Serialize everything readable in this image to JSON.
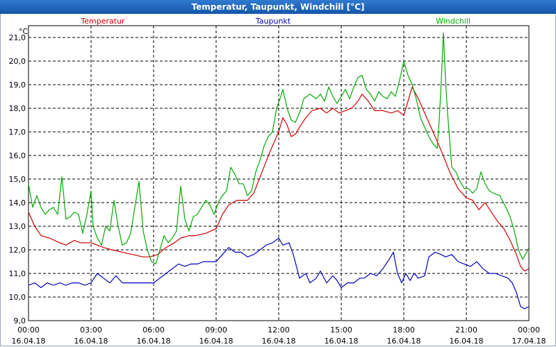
{
  "window": {
    "title": "Temperatur, Taupunkt, Windchill [°C]"
  },
  "chart_data": {
    "type": "line",
    "title": "Temperatur, Taupunkt, Windchill [°C]",
    "ylabel": "°C",
    "xlabel": "",
    "ylim": [
      9.0,
      21.5
    ],
    "xlim": [
      0,
      24
    ],
    "grid": true,
    "legend_position": "top",
    "yticks": [
      "9,0",
      "10,0",
      "11,0",
      "12,0",
      "13,0",
      "14,0",
      "15,0",
      "16,0",
      "17,0",
      "18,0",
      "19,0",
      "20,0",
      "21,0"
    ],
    "xticks": [
      {
        "time": "00:00",
        "date": "16.04.18"
      },
      {
        "time": "03:00",
        "date": "16.04.18"
      },
      {
        "time": "06:00",
        "date": "16.04.18"
      },
      {
        "time": "09:00",
        "date": "16.04.18"
      },
      {
        "time": "12:00",
        "date": "16.04.18"
      },
      {
        "time": "15:00",
        "date": "16.04.18"
      },
      {
        "time": "18:00",
        "date": "16.04.18"
      },
      {
        "time": "21:00",
        "date": "16.04.18"
      },
      {
        "time": "00:00",
        "date": "17.04.18"
      }
    ],
    "series": [
      {
        "name": "Temperatur",
        "color": "#cc0000",
        "points": [
          [
            0.0,
            13.6
          ],
          [
            0.3,
            13.0
          ],
          [
            0.6,
            12.6
          ],
          [
            1.0,
            12.5
          ],
          [
            1.5,
            12.3
          ],
          [
            1.8,
            12.2
          ],
          [
            2.2,
            12.4
          ],
          [
            2.5,
            12.3
          ],
          [
            3.0,
            12.3
          ],
          [
            3.3,
            12.2
          ],
          [
            3.6,
            12.1
          ],
          [
            4.0,
            12.0
          ],
          [
            4.5,
            11.9
          ],
          [
            5.0,
            11.8
          ],
          [
            5.5,
            11.7
          ],
          [
            5.8,
            11.7
          ],
          [
            6.2,
            11.8
          ],
          [
            6.6,
            12.1
          ],
          [
            7.0,
            12.3
          ],
          [
            7.3,
            12.5
          ],
          [
            7.7,
            12.6
          ],
          [
            8.0,
            12.6
          ],
          [
            8.5,
            12.7
          ],
          [
            9.0,
            12.9
          ],
          [
            9.3,
            13.5
          ],
          [
            9.6,
            13.9
          ],
          [
            10.0,
            14.1
          ],
          [
            10.5,
            14.1
          ],
          [
            10.8,
            14.4
          ],
          [
            11.2,
            15.3
          ],
          [
            11.6,
            16.2
          ],
          [
            12.0,
            17.0
          ],
          [
            12.2,
            17.6
          ],
          [
            12.4,
            17.3
          ],
          [
            12.6,
            16.8
          ],
          [
            12.8,
            16.9
          ],
          [
            13.0,
            17.2
          ],
          [
            13.3,
            17.6
          ],
          [
            13.6,
            17.9
          ],
          [
            14.0,
            18.0
          ],
          [
            14.3,
            17.8
          ],
          [
            14.6,
            18.0
          ],
          [
            14.9,
            17.8
          ],
          [
            15.2,
            17.9
          ],
          [
            15.5,
            18.0
          ],
          [
            15.8,
            18.3
          ],
          [
            16.0,
            18.6
          ],
          [
            16.3,
            18.3
          ],
          [
            16.6,
            17.9
          ],
          [
            17.0,
            17.9
          ],
          [
            17.4,
            17.8
          ],
          [
            17.7,
            17.9
          ],
          [
            18.0,
            17.7
          ],
          [
            18.2,
            18.3
          ],
          [
            18.4,
            18.9
          ],
          [
            18.7,
            18.4
          ],
          [
            19.0,
            17.8
          ],
          [
            19.4,
            17.0
          ],
          [
            19.8,
            16.2
          ],
          [
            20.2,
            15.3
          ],
          [
            20.6,
            14.6
          ],
          [
            21.0,
            14.2
          ],
          [
            21.3,
            14.1
          ],
          [
            21.6,
            13.7
          ],
          [
            21.9,
            14.0
          ],
          [
            22.2,
            13.6
          ],
          [
            22.5,
            13.2
          ],
          [
            22.8,
            12.9
          ],
          [
            23.1,
            12.4
          ],
          [
            23.4,
            11.8
          ],
          [
            23.6,
            11.3
          ],
          [
            23.8,
            11.1
          ],
          [
            24.0,
            11.2
          ]
        ]
      },
      {
        "name": "Taupunkt",
        "color": "#0000bb",
        "points": [
          [
            0.0,
            10.5
          ],
          [
            0.3,
            10.6
          ],
          [
            0.6,
            10.4
          ],
          [
            0.9,
            10.6
          ],
          [
            1.2,
            10.5
          ],
          [
            1.5,
            10.6
          ],
          [
            1.8,
            10.5
          ],
          [
            2.1,
            10.6
          ],
          [
            2.4,
            10.6
          ],
          [
            2.7,
            10.5
          ],
          [
            3.0,
            10.6
          ],
          [
            3.3,
            11.0
          ],
          [
            3.6,
            10.8
          ],
          [
            3.9,
            10.6
          ],
          [
            4.2,
            10.9
          ],
          [
            4.5,
            10.6
          ],
          [
            4.8,
            10.6
          ],
          [
            5.1,
            10.6
          ],
          [
            5.4,
            10.6
          ],
          [
            5.7,
            10.6
          ],
          [
            6.0,
            10.6
          ],
          [
            6.3,
            10.8
          ],
          [
            6.6,
            11.0
          ],
          [
            6.9,
            11.2
          ],
          [
            7.2,
            11.4
          ],
          [
            7.5,
            11.3
          ],
          [
            7.8,
            11.4
          ],
          [
            8.1,
            11.4
          ],
          [
            8.4,
            11.5
          ],
          [
            8.7,
            11.5
          ],
          [
            9.0,
            11.5
          ],
          [
            9.3,
            11.8
          ],
          [
            9.6,
            12.1
          ],
          [
            9.9,
            11.9
          ],
          [
            10.2,
            11.9
          ],
          [
            10.5,
            11.7
          ],
          [
            10.8,
            11.8
          ],
          [
            11.1,
            12.0
          ],
          [
            11.4,
            12.2
          ],
          [
            11.7,
            12.3
          ],
          [
            12.0,
            12.5
          ],
          [
            12.2,
            12.2
          ],
          [
            12.5,
            12.3
          ],
          [
            12.7,
            11.8
          ],
          [
            13.0,
            10.8
          ],
          [
            13.3,
            11.0
          ],
          [
            13.5,
            10.6
          ],
          [
            13.8,
            10.8
          ],
          [
            14.0,
            11.1
          ],
          [
            14.3,
            10.6
          ],
          [
            14.6,
            10.9
          ],
          [
            14.8,
            10.7
          ],
          [
            15.0,
            10.4
          ],
          [
            15.3,
            10.6
          ],
          [
            15.6,
            10.6
          ],
          [
            15.9,
            10.8
          ],
          [
            16.1,
            10.8
          ],
          [
            16.4,
            11.0
          ],
          [
            16.7,
            10.9
          ],
          [
            17.0,
            11.2
          ],
          [
            17.3,
            11.6
          ],
          [
            17.5,
            11.9
          ],
          [
            17.7,
            11.0
          ],
          [
            17.9,
            10.6
          ],
          [
            18.1,
            11.0
          ],
          [
            18.3,
            10.7
          ],
          [
            18.5,
            11.0
          ],
          [
            18.7,
            10.8
          ],
          [
            19.0,
            10.9
          ],
          [
            19.2,
            11.7
          ],
          [
            19.5,
            11.9
          ],
          [
            19.8,
            11.8
          ],
          [
            20.0,
            11.7
          ],
          [
            20.3,
            11.8
          ],
          [
            20.6,
            11.5
          ],
          [
            20.9,
            11.4
          ],
          [
            21.2,
            11.3
          ],
          [
            21.5,
            11.5
          ],
          [
            21.8,
            11.2
          ],
          [
            22.1,
            11.0
          ],
          [
            22.4,
            11.0
          ],
          [
            22.7,
            10.9
          ],
          [
            23.0,
            10.8
          ],
          [
            23.2,
            10.6
          ],
          [
            23.4,
            10.2
          ],
          [
            23.6,
            9.6
          ],
          [
            23.8,
            9.5
          ],
          [
            24.0,
            9.6
          ]
        ]
      },
      {
        "name": "Windchill",
        "color": "#00aa00",
        "points": [
          [
            0.0,
            14.8
          ],
          [
            0.2,
            13.8
          ],
          [
            0.4,
            14.3
          ],
          [
            0.6,
            13.8
          ],
          [
            0.8,
            13.5
          ],
          [
            1.0,
            13.7
          ],
          [
            1.2,
            13.8
          ],
          [
            1.4,
            13.5
          ],
          [
            1.6,
            15.1
          ],
          [
            1.8,
            13.3
          ],
          [
            2.0,
            13.4
          ],
          [
            2.2,
            13.6
          ],
          [
            2.4,
            13.5
          ],
          [
            2.6,
            12.7
          ],
          [
            2.8,
            13.5
          ],
          [
            3.0,
            14.5
          ],
          [
            3.1,
            13.0
          ],
          [
            3.3,
            12.5
          ],
          [
            3.5,
            12.2
          ],
          [
            3.7,
            13.0
          ],
          [
            3.9,
            12.8
          ],
          [
            4.1,
            14.1
          ],
          [
            4.3,
            13.0
          ],
          [
            4.5,
            12.2
          ],
          [
            4.7,
            12.3
          ],
          [
            4.9,
            12.7
          ],
          [
            5.1,
            13.8
          ],
          [
            5.3,
            14.9
          ],
          [
            5.5,
            12.8
          ],
          [
            5.7,
            12.0
          ],
          [
            5.9,
            11.5
          ],
          [
            6.1,
            11.4
          ],
          [
            6.3,
            12.0
          ],
          [
            6.5,
            12.6
          ],
          [
            6.7,
            12.3
          ],
          [
            6.9,
            12.5
          ],
          [
            7.1,
            12.8
          ],
          [
            7.3,
            14.7
          ],
          [
            7.5,
            13.3
          ],
          [
            7.7,
            12.8
          ],
          [
            7.9,
            13.4
          ],
          [
            8.1,
            13.5
          ],
          [
            8.3,
            13.8
          ],
          [
            8.5,
            14.1
          ],
          [
            8.7,
            13.9
          ],
          [
            8.9,
            13.5
          ],
          [
            9.1,
            14.0
          ],
          [
            9.3,
            14.3
          ],
          [
            9.5,
            14.5
          ],
          [
            9.7,
            15.5
          ],
          [
            9.9,
            15.2
          ],
          [
            10.1,
            14.8
          ],
          [
            10.3,
            14.8
          ],
          [
            10.5,
            14.3
          ],
          [
            10.7,
            14.5
          ],
          [
            10.9,
            15.3
          ],
          [
            11.1,
            15.8
          ],
          [
            11.3,
            16.4
          ],
          [
            11.5,
            16.8
          ],
          [
            11.7,
            17.0
          ],
          [
            11.9,
            18.0
          ],
          [
            12.1,
            18.5
          ],
          [
            12.2,
            18.8
          ],
          [
            12.4,
            18.0
          ],
          [
            12.6,
            17.5
          ],
          [
            12.8,
            17.4
          ],
          [
            13.0,
            17.8
          ],
          [
            13.2,
            18.4
          ],
          [
            13.5,
            18.6
          ],
          [
            13.8,
            18.4
          ],
          [
            14.0,
            18.6
          ],
          [
            14.2,
            18.3
          ],
          [
            14.4,
            18.9
          ],
          [
            14.6,
            18.5
          ],
          [
            14.8,
            18.2
          ],
          [
            15.0,
            18.5
          ],
          [
            15.2,
            18.8
          ],
          [
            15.4,
            18.4
          ],
          [
            15.6,
            18.9
          ],
          [
            15.8,
            19.3
          ],
          [
            16.0,
            19.4
          ],
          [
            16.2,
            18.8
          ],
          [
            16.4,
            18.6
          ],
          [
            16.6,
            18.3
          ],
          [
            16.8,
            18.7
          ],
          [
            17.0,
            18.5
          ],
          [
            17.2,
            18.4
          ],
          [
            17.4,
            18.7
          ],
          [
            17.6,
            18.5
          ],
          [
            17.8,
            19.2
          ],
          [
            18.0,
            20.0
          ],
          [
            18.2,
            19.4
          ],
          [
            18.4,
            19.0
          ],
          [
            18.6,
            18.4
          ],
          [
            18.8,
            17.6
          ],
          [
            19.0,
            17.2
          ],
          [
            19.2,
            16.8
          ],
          [
            19.4,
            16.5
          ],
          [
            19.6,
            16.3
          ],
          [
            19.7,
            17.5
          ],
          [
            19.8,
            19.2
          ],
          [
            19.9,
            21.2
          ],
          [
            20.0,
            19.2
          ],
          [
            20.1,
            17.8
          ],
          [
            20.3,
            15.5
          ],
          [
            20.5,
            15.3
          ],
          [
            20.7,
            14.9
          ],
          [
            20.9,
            14.6
          ],
          [
            21.1,
            14.6
          ],
          [
            21.3,
            14.4
          ],
          [
            21.5,
            14.6
          ],
          [
            21.7,
            15.3
          ],
          [
            21.9,
            14.8
          ],
          [
            22.1,
            14.5
          ],
          [
            22.3,
            14.4
          ],
          [
            22.6,
            14.3
          ],
          [
            22.9,
            13.8
          ],
          [
            23.1,
            13.4
          ],
          [
            23.3,
            12.8
          ],
          [
            23.5,
            12.0
          ],
          [
            23.7,
            11.6
          ],
          [
            23.9,
            11.9
          ],
          [
            24.0,
            12.1
          ]
        ]
      }
    ]
  }
}
